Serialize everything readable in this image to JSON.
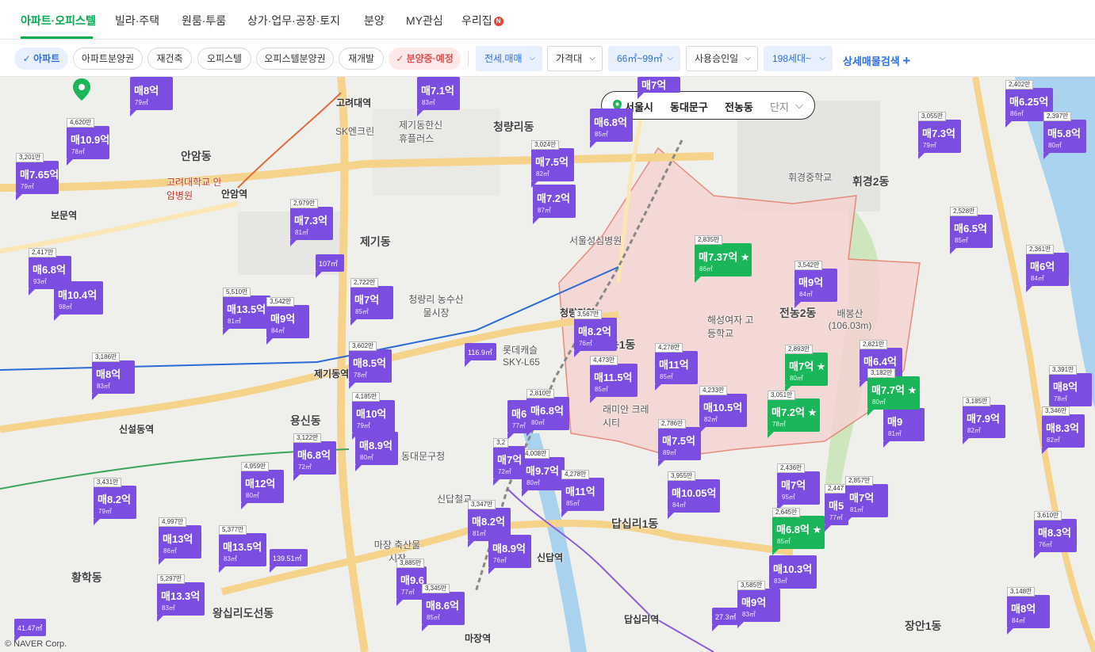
{
  "nav": {
    "tabs": [
      {
        "label": "아파트·오피스텔",
        "active": true
      },
      {
        "label": "빌라·주택"
      },
      {
        "label": "원룸·투룸"
      },
      {
        "label": "상가·업무·공장·토지"
      },
      {
        "label": "분양"
      },
      {
        "label": "MY관심"
      },
      {
        "label": "우리집"
      }
    ],
    "badge": "N"
  },
  "filters": {
    "chips": [
      "아파트",
      "아파트분양권",
      "재건축",
      "오피스텔",
      "오피스텔분양권",
      "재개발",
      "분양중·예정"
    ],
    "selects": [
      "전세,매매",
      "가격대",
      "66㎡~99㎡",
      "사용승인일",
      "198세대~"
    ],
    "detail": "상세매물검색",
    "plus": "+"
  },
  "location": {
    "city": "서울시",
    "district": "동대문구",
    "dong": "전농동",
    "complex": "단지"
  },
  "map_labels": [
    {
      "t": "고려대역",
      "c": "station"
    },
    {
      "t": "안암동",
      "c": "big"
    },
    {
      "t": "안암역",
      "c": "station"
    },
    {
      "t": "보문역",
      "c": "station"
    },
    {
      "t": "청량리동",
      "c": "big"
    },
    {
      "t": "제기동",
      "c": "big"
    },
    {
      "t": "제기동역",
      "c": "station"
    },
    {
      "t": "청량리 농수산물시장",
      "c": ""
    },
    {
      "t": "용신동",
      "c": "big"
    },
    {
      "t": "신설동역",
      "c": "station"
    },
    {
      "t": "휘경2동",
      "c": "big"
    },
    {
      "t": "전농2동",
      "c": "big"
    },
    {
      "t": "전농1동",
      "c": "big"
    },
    {
      "t": "답십리1동",
      "c": "big"
    },
    {
      "t": "답십리역",
      "c": "station"
    },
    {
      "t": "신답역",
      "c": "station"
    },
    {
      "t": "마장역",
      "c": "station"
    },
    {
      "t": "왕십리도선동",
      "c": "big"
    },
    {
      "t": "황학동",
      "c": "big"
    },
    {
      "t": "장안1동",
      "c": "big"
    },
    {
      "t": "롯데캐슬 SKY-L65",
      "c": ""
    },
    {
      "t": "래미안 크레시티",
      "c": ""
    },
    {
      "t": "배봉산 (106.03m)",
      "c": ""
    },
    {
      "t": "신답철교",
      "c": ""
    },
    {
      "t": "청량리역",
      "c": "station"
    },
    {
      "t": "서울성심병원",
      "c": ""
    },
    {
      "t": "휘경중학교",
      "c": ""
    },
    {
      "t": "해성여자 고등학교",
      "c": ""
    },
    {
      "t": "SK엔크린",
      "c": ""
    },
    {
      "t": "고려대학교 안암병원",
      "c": ""
    },
    {
      "t": "마장 축산물시장",
      "c": ""
    },
    {
      "t": "동대문구청",
      "c": ""
    },
    {
      "t": "제기동한신 휴플러스",
      "c": ""
    }
  ],
  "markers": [
    {
      "pp": "",
      "pr": "매8억",
      "ar": "79㎡"
    },
    {
      "pp": "",
      "pr": "매7.1억",
      "ar": "83㎡"
    },
    {
      "pp": "",
      "pr": "매7억",
      "ar": ""
    },
    {
      "pp": "4,620만",
      "pr": "매10.9억",
      "ar": "78㎡"
    },
    {
      "pp": "3,201만",
      "pr": "매7.65억",
      "ar": "79㎡"
    },
    {
      "pp": "3,024만",
      "pr": "매7.5억",
      "ar": "82㎡"
    },
    {
      "pp": "",
      "pr": "매7.2억",
      "ar": "87㎡"
    },
    {
      "pp": "",
      "pr": "매6.8억",
      "ar": "85㎡"
    },
    {
      "pp": "2,979만",
      "pr": "매7.3억",
      "ar": "81㎡"
    },
    {
      "pp": "2,417만",
      "pr": "매6.8억",
      "ar": "93㎡"
    },
    {
      "pp": "",
      "pr": "매10.4억",
      "ar": "98㎡"
    },
    {
      "pp": "5,510만",
      "pr": "매13.5억",
      "ar": "81㎡"
    },
    {
      "pp": "3,542만",
      "pr": "매9억",
      "ar": "84㎡"
    },
    {
      "pp": "2,722만",
      "pr": "매7억",
      "ar": "85㎡"
    },
    {
      "pp": "3,186만",
      "pr": "매8억",
      "ar": "83㎡"
    },
    {
      "pp": "3,602만",
      "pr": "매8.5억",
      "ar": "78㎡"
    },
    {
      "pp": "4,185만",
      "pr": "매10억",
      "ar": "79㎡"
    },
    {
      "pp": "",
      "pr": "매8.9억",
      "ar": "80㎡"
    },
    {
      "pp": "3,122만",
      "pr": "매6.8억",
      "ar": "72㎡"
    },
    {
      "pp": "3,431만",
      "pr": "매8.2억",
      "ar": "79㎡"
    },
    {
      "pp": "4,959만",
      "pr": "매12억",
      "ar": "80㎡"
    },
    {
      "pp": "4,997만",
      "pr": "매13억",
      "ar": "86㎡"
    },
    {
      "pp": "5,377만",
      "pr": "매13.5억",
      "ar": "83㎡"
    },
    {
      "pp": "5,297만",
      "pr": "매13.3억",
      "ar": "83㎡"
    },
    {
      "pp": "3,567만",
      "pr": "매8.2억",
      "ar": "76㎡"
    },
    {
      "pp": "4,473만",
      "pr": "매11.5억",
      "ar": "85㎡"
    },
    {
      "pp": "4,278만",
      "pr": "매11억",
      "ar": "85㎡"
    },
    {
      "pp": "2,810만",
      "pr": "매6.8억",
      "ar": "80㎡"
    },
    {
      "pp": "4,008만",
      "pr": "매9.7억",
      "ar": "80㎡"
    },
    {
      "pp": "3,2",
      "pr": "매7억",
      "ar": "72㎡"
    },
    {
      "pp": "4,278만",
      "pr": "매11억",
      "ar": "85㎡"
    },
    {
      "pp": "3,347만",
      "pr": "매8.2억",
      "ar": "81㎡"
    },
    {
      "pp": "",
      "pr": "매8.9억",
      "ar": "76㎡"
    },
    {
      "pp": "3,885만",
      "pr": "매9.6",
      "ar": "77㎡"
    },
    {
      "pp": "3,345만",
      "pr": "매8.6억",
      "ar": "85㎡"
    },
    {
      "pp": "4,233만",
      "pr": "매10.5억",
      "ar": "82㎡"
    },
    {
      "pp": "2,786만",
      "pr": "매7.5억",
      "ar": "89㎡"
    },
    {
      "pp": "3,955만",
      "pr": "매10.05억",
      "ar": "84㎡"
    },
    {
      "pp": "3,542만",
      "pr": "매9억",
      "ar": "84㎡"
    },
    {
      "pp": "2,821만",
      "pr": "매6.4억",
      "ar": ""
    },
    {
      "pp": "2,436만",
      "pr": "매7억",
      "ar": "95㎡"
    },
    {
      "pp": "2,857만",
      "pr": "매7억",
      "ar": "81㎡"
    },
    {
      "pp": "",
      "pr": "매10.3억",
      "ar": "83㎡"
    },
    {
      "pp": "3,585만",
      "pr": "매9억",
      "ar": "83㎡"
    },
    {
      "pp": "2,402만",
      "pr": "매6.25억",
      "ar": "86㎡"
    },
    {
      "pp": "3,055만",
      "pr": "매7.3억",
      "ar": "79㎡"
    },
    {
      "pp": "2,397만",
      "pr": "매5.8억",
      "ar": "80㎡"
    },
    {
      "pp": "2,528만",
      "pr": "매6.5억",
      "ar": "85㎡"
    },
    {
      "pp": "2,361만",
      "pr": "매6억",
      "ar": "84㎡"
    },
    {
      "pp": "3,391만",
      "pr": "매8억",
      "ar": "78㎡"
    },
    {
      "pp": "3,185만",
      "pr": "매7.9억",
      "ar": "82㎡"
    },
    {
      "pp": "3,346만",
      "pr": "매8.3억",
      "ar": "82㎡"
    },
    {
      "pp": "3,610만",
      "pr": "매8.3억",
      "ar": "76㎡"
    },
    {
      "pp": "3,148만",
      "pr": "매8억",
      "ar": "84㎡"
    },
    {
      "pp": "",
      "pr": "매9",
      "ar": "81㎡"
    },
    {
      "pp": "",
      "pr": "매6",
      "ar": "77㎡"
    },
    {
      "pp": "2,447",
      "pr": "매5",
      "ar": "77㎡"
    }
  ],
  "green_markers": [
    {
      "pp": "2,835만",
      "pr": "매7.37억 ★",
      "ar": "86㎡"
    },
    {
      "pp": "2,893만",
      "pr": "매7억 ★",
      "ar": "80㎡"
    },
    {
      "pp": "3,051만",
      "pr": "매7.2억 ★",
      "ar": "78㎡"
    },
    {
      "pp": "3,182만",
      "pr": "매7.7억 ★",
      "ar": "80㎡"
    },
    {
      "pp": "2,645만",
      "pr": "매6.8억 ★",
      "ar": "85㎡"
    }
  ],
  "small_markers": [
    "107㎡",
    "116.9㎡",
    "139.51㎡",
    "41.47㎡",
    "27.3㎡"
  ],
  "copyright": "© NAVER Corp."
}
